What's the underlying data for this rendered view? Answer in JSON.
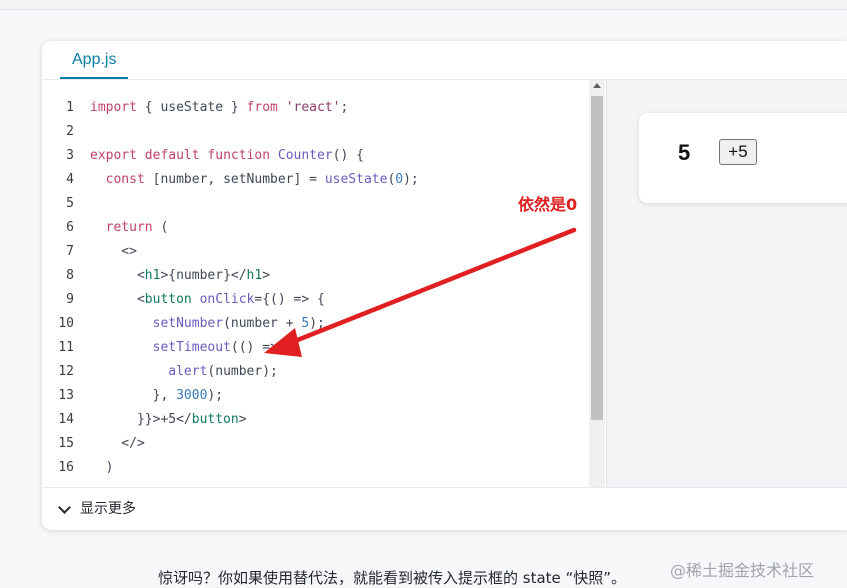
{
  "tab": {
    "label": "App.js"
  },
  "code": {
    "lines": [
      [
        {
          "t": "import",
          "c": "kw"
        },
        {
          "t": " { useState } "
        },
        {
          "t": "from",
          "c": "kw"
        },
        {
          "t": " "
        },
        {
          "t": "'react'",
          "c": "str"
        },
        {
          "t": ";"
        }
      ],
      [],
      [
        {
          "t": "export",
          "c": "kw"
        },
        {
          "t": " "
        },
        {
          "t": "default",
          "c": "kw"
        },
        {
          "t": " "
        },
        {
          "t": "function",
          "c": "kw"
        },
        {
          "t": " "
        },
        {
          "t": "Counter",
          "c": "fn"
        },
        {
          "t": "() {"
        }
      ],
      [
        {
          "t": "  "
        },
        {
          "t": "const",
          "c": "kw"
        },
        {
          "t": " [number, setNumber] = "
        },
        {
          "t": "useState",
          "c": "fn"
        },
        {
          "t": "("
        },
        {
          "t": "0",
          "c": "num"
        },
        {
          "t": ");"
        }
      ],
      [],
      [
        {
          "t": "  "
        },
        {
          "t": "return",
          "c": "kw"
        },
        {
          "t": " ("
        }
      ],
      [
        {
          "t": "    <>"
        }
      ],
      [
        {
          "t": "      <"
        },
        {
          "t": "h1",
          "c": "tag"
        },
        {
          "t": ">{number}</"
        },
        {
          "t": "h1",
          "c": "tag"
        },
        {
          "t": ">"
        }
      ],
      [
        {
          "t": "      <"
        },
        {
          "t": "button",
          "c": "tag"
        },
        {
          "t": " "
        },
        {
          "t": "onClick",
          "c": "fn"
        },
        {
          "t": "={() => {"
        }
      ],
      [
        {
          "t": "        "
        },
        {
          "t": "setNumber",
          "c": "fn"
        },
        {
          "t": "(number + "
        },
        {
          "t": "5",
          "c": "num"
        },
        {
          "t": ");"
        }
      ],
      [
        {
          "t": "        "
        },
        {
          "t": "setTimeout",
          "c": "fn"
        },
        {
          "t": "(() => {"
        }
      ],
      [
        {
          "t": "          "
        },
        {
          "t": "alert",
          "c": "fn"
        },
        {
          "t": "(number);"
        }
      ],
      [
        {
          "t": "        }, "
        },
        {
          "t": "3000",
          "c": "num"
        },
        {
          "t": ");"
        }
      ],
      [
        {
          "t": "      }}>+5</"
        },
        {
          "t": "button",
          "c": "tag"
        },
        {
          "t": ">"
        }
      ],
      [
        {
          "t": "    </>"
        }
      ],
      [
        {
          "t": "  )"
        }
      ]
    ]
  },
  "preview": {
    "number": "5",
    "button_label": "+5"
  },
  "footer": {
    "show_more": "显示更多"
  },
  "annotation": {
    "text": "依然是0",
    "color": "#e02020"
  },
  "bottom_text": "惊讶吗？你如果使用替代法，就能看到被传入提示框的 state “快照”。",
  "watermark": "@稀土掘金技术社区"
}
